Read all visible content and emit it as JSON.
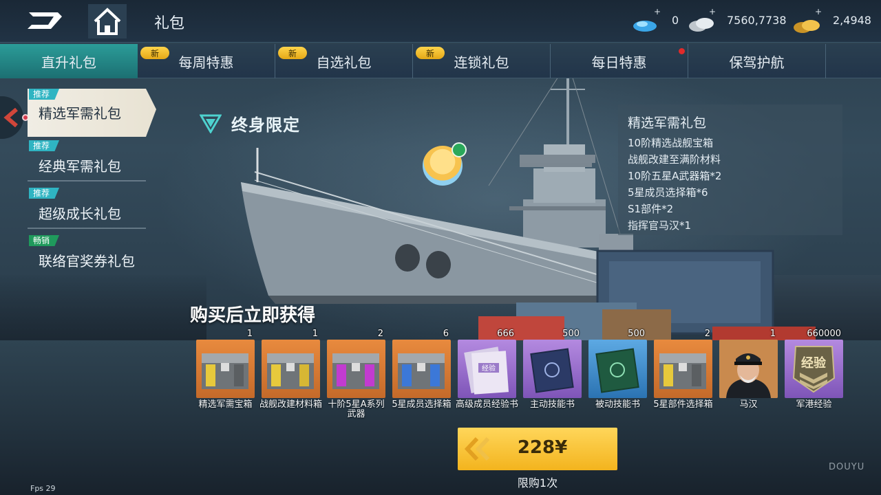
{
  "topbar": {
    "title": "礼包",
    "resources": [
      {
        "icon": "gem-icon",
        "value": "0"
      },
      {
        "icon": "silver-coin-icon",
        "value": "7560,7738"
      },
      {
        "icon": "gold-coin-icon",
        "value": "2,4948"
      }
    ],
    "plus": "+"
  },
  "tabs": [
    {
      "label": "直升礼包",
      "new": "",
      "active": true
    },
    {
      "label": "每周特惠",
      "new": "新"
    },
    {
      "label": "自选礼包",
      "new": "新"
    },
    {
      "label": "连锁礼包",
      "new": "新"
    },
    {
      "label": "每日特惠",
      "new": "",
      "dot": true
    },
    {
      "label": "保驾护航",
      "new": ""
    }
  ],
  "menu": [
    {
      "tag": "推荐",
      "label": "精选军需礼包",
      "active": true
    },
    {
      "tag": "推荐",
      "label": "经典军需礼包"
    },
    {
      "tag": "推荐",
      "label": "超级成长礼包"
    },
    {
      "tag": "畅销",
      "label": "联络官奖券礼包"
    }
  ],
  "content": {
    "lifetime_label": "终身限定",
    "get_now": "购买后立即获得"
  },
  "description": {
    "title": "精选军需礼包",
    "lines": [
      "10阶精选战舰宝箱",
      "战舰改建至满阶材料",
      "10阶五星A武器箱*2",
      "5星成员选择箱*6",
      "S1部件*2",
      "指挥官马汉*1"
    ]
  },
  "items": [
    {
      "name": "精选军需宝箱",
      "count": "1",
      "rarity": "orange",
      "icon": "chest-icon"
    },
    {
      "name": "战舰改建材料箱",
      "count": "1",
      "rarity": "orange",
      "icon": "chest-icon"
    },
    {
      "name": "十阶5星A系列武器",
      "count": "2",
      "rarity": "orange",
      "icon": "chest-icon"
    },
    {
      "name": "5星成员选择箱",
      "count": "6",
      "rarity": "orange",
      "icon": "chest-icon"
    },
    {
      "name": "高级成员经验书",
      "count": "666",
      "rarity": "purple",
      "icon": "book-icon",
      "book_text": "经验"
    },
    {
      "name": "主动技能书",
      "count": "500",
      "rarity": "purple",
      "icon": "skill-book-icon"
    },
    {
      "name": "被动技能书",
      "count": "500",
      "rarity": "blue",
      "icon": "skill-book-icon"
    },
    {
      "name": "5星部件选择箱",
      "count": "2",
      "rarity": "orange",
      "icon": "chest-icon"
    },
    {
      "name": "马汉",
      "count": "1",
      "rarity": "orange",
      "icon": "captain-portrait"
    },
    {
      "name": "军港经验",
      "count": "660000",
      "rarity": "purple",
      "icon": "exp-badge-icon",
      "badge_text": "经验"
    }
  ],
  "buy": {
    "price": "228¥",
    "limit": "限购1次"
  },
  "footer": {
    "fps": "Fps 29",
    "watermark": "DOUYU"
  }
}
